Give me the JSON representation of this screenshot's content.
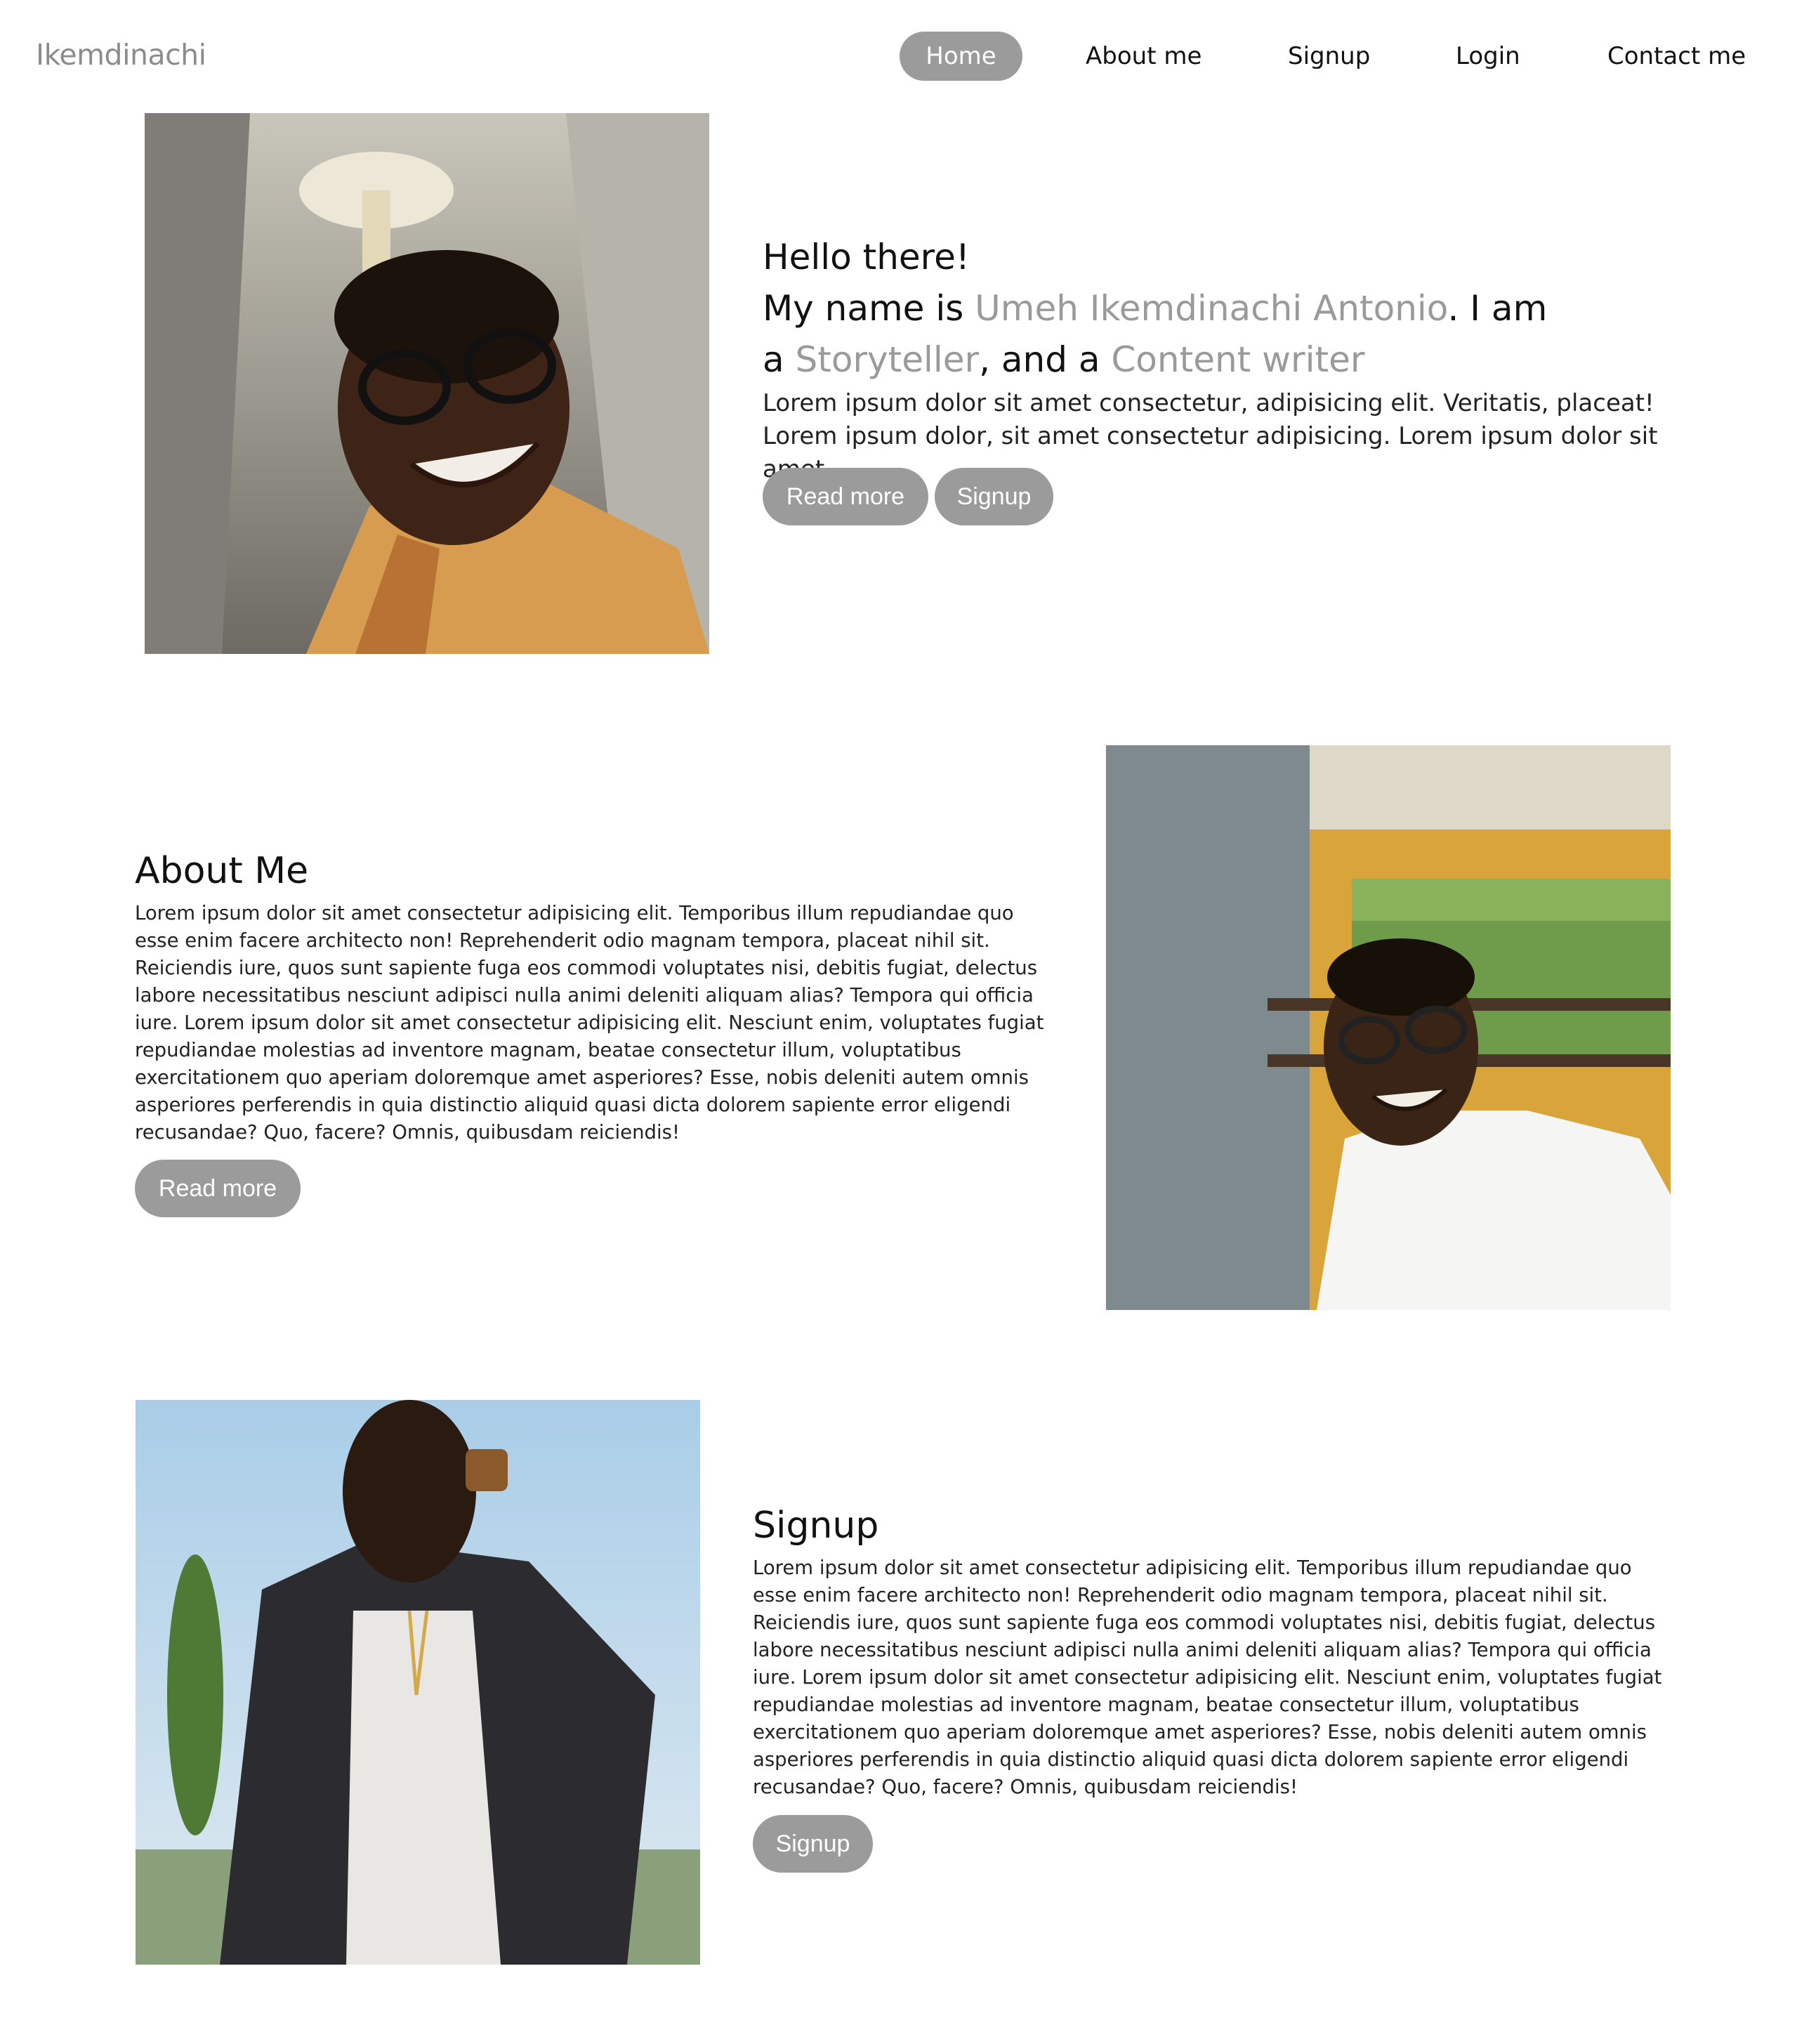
{
  "brand": "Ikemdinachi",
  "nav": {
    "home": "Home",
    "about": "About me",
    "signup": "Signup",
    "login": "Login",
    "contact": "Contact me"
  },
  "hero": {
    "greeting": "Hello there!",
    "name_prefix": "My name is ",
    "name": "Umeh Ikemdinachi Antonio",
    "name_suffix": ". I am",
    "role_prefix": "a ",
    "role1": "Storyteller",
    "role_join": ", and a ",
    "role2": "Content writer",
    "line1": "Lorem ipsum dolor sit amet consectetur, adipisicing elit. Veritatis, placeat!",
    "line2": "Lorem ipsum dolor, sit amet consectetur adipisicing. Lorem ipsum dolor sit amet.",
    "read_more": "Read more",
    "signup": "Signup"
  },
  "about": {
    "title": "About Me",
    "body": "Lorem ipsum dolor sit amet consectetur adipisicing elit. Temporibus illum repudiandae quo esse enim facere architecto non! Reprehenderit odio magnam tempora, placeat nihil sit. Reiciendis iure, quos sunt sapiente fuga eos commodi voluptates nisi, debitis fugiat, delectus labore necessitatibus nesciunt adipisci nulla animi deleniti aliquam alias? Tempora qui officia iure. Lorem ipsum dolor sit amet consectetur adipisicing elit. Nesciunt enim, voluptates fugiat repudiandae molestias ad inventore magnam, beatae consectetur illum, voluptatibus exercitationem quo aperiam doloremque amet asperiores? Esse, nobis deleniti autem omnis asperiores perferendis in quia distinctio aliquid quasi dicta dolorem sapiente error eligendi recusandae? Quo, facere? Omnis, quibusdam reiciendis!",
    "read_more": "Read more"
  },
  "signup_section": {
    "title": "Signup",
    "body": "Lorem ipsum dolor sit amet consectetur adipisicing elit. Temporibus illum repudiandae quo esse enim facere architecto non! Reprehenderit odio magnam tempora, placeat nihil sit. Reiciendis iure, quos sunt sapiente fuga eos commodi voluptates nisi, debitis fugiat, delectus labore necessitatibus nesciunt adipisci nulla animi deleniti aliquam alias? Tempora qui officia iure. Lorem ipsum dolor sit amet consectetur adipisicing elit. Nesciunt enim, voluptates fugiat repudiandae molestias ad inventore magnam, beatae consectetur illum, voluptatibus exercitationem quo aperiam doloremque amet asperiores? Esse, nobis deleniti autem omnis asperiores perferendis in quia distinctio aliquid quasi dicta dolorem sapiente error eligendi recusandae? Quo, facere? Omnis, quibusdam reiciendis!",
    "button": "Signup"
  },
  "colors": {
    "accent": "#9b9b9b",
    "text": "#111111",
    "background": "#ffffff"
  }
}
